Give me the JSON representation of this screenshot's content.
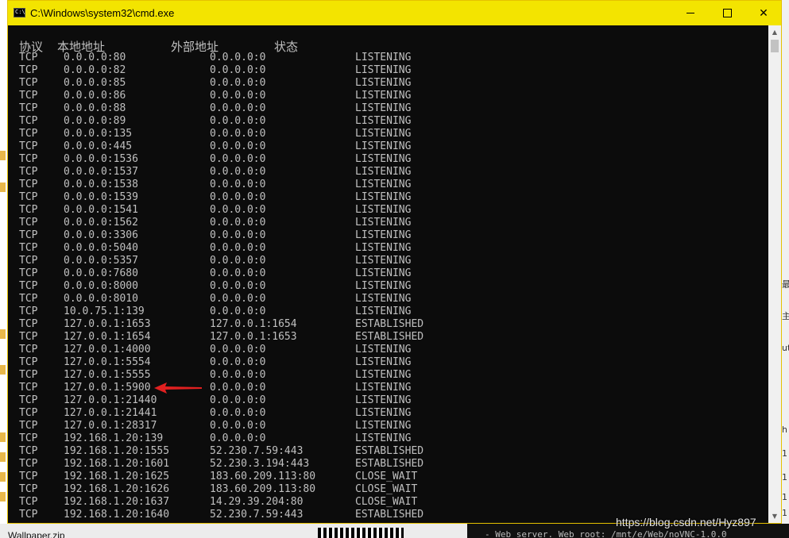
{
  "window": {
    "title": "C:\\Windows\\system32\\cmd.exe",
    "icon_text": "C:\\",
    "minimize_icon": "minimize-icon",
    "maximize_icon": "maximize-icon",
    "close_glyph": "✕"
  },
  "console": {
    "headers": {
      "proto": "协议",
      "local": "本地地址",
      "foreign": "外部地址",
      "state": "状态"
    },
    "rows": [
      {
        "proto": "TCP",
        "local": "0.0.0.0:80",
        "foreign": "0.0.0.0:0",
        "state": "LISTENING"
      },
      {
        "proto": "TCP",
        "local": "0.0.0.0:82",
        "foreign": "0.0.0.0:0",
        "state": "LISTENING"
      },
      {
        "proto": "TCP",
        "local": "0.0.0.0:85",
        "foreign": "0.0.0.0:0",
        "state": "LISTENING"
      },
      {
        "proto": "TCP",
        "local": "0.0.0.0:86",
        "foreign": "0.0.0.0:0",
        "state": "LISTENING"
      },
      {
        "proto": "TCP",
        "local": "0.0.0.0:88",
        "foreign": "0.0.0.0:0",
        "state": "LISTENING"
      },
      {
        "proto": "TCP",
        "local": "0.0.0.0:89",
        "foreign": "0.0.0.0:0",
        "state": "LISTENING"
      },
      {
        "proto": "TCP",
        "local": "0.0.0.0:135",
        "foreign": "0.0.0.0:0",
        "state": "LISTENING"
      },
      {
        "proto": "TCP",
        "local": "0.0.0.0:445",
        "foreign": "0.0.0.0:0",
        "state": "LISTENING"
      },
      {
        "proto": "TCP",
        "local": "0.0.0.0:1536",
        "foreign": "0.0.0.0:0",
        "state": "LISTENING"
      },
      {
        "proto": "TCP",
        "local": "0.0.0.0:1537",
        "foreign": "0.0.0.0:0",
        "state": "LISTENING"
      },
      {
        "proto": "TCP",
        "local": "0.0.0.0:1538",
        "foreign": "0.0.0.0:0",
        "state": "LISTENING"
      },
      {
        "proto": "TCP",
        "local": "0.0.0.0:1539",
        "foreign": "0.0.0.0:0",
        "state": "LISTENING"
      },
      {
        "proto": "TCP",
        "local": "0.0.0.0:1541",
        "foreign": "0.0.0.0:0",
        "state": "LISTENING"
      },
      {
        "proto": "TCP",
        "local": "0.0.0.0:1562",
        "foreign": "0.0.0.0:0",
        "state": "LISTENING"
      },
      {
        "proto": "TCP",
        "local": "0.0.0.0:3306",
        "foreign": "0.0.0.0:0",
        "state": "LISTENING"
      },
      {
        "proto": "TCP",
        "local": "0.0.0.0:5040",
        "foreign": "0.0.0.0:0",
        "state": "LISTENING"
      },
      {
        "proto": "TCP",
        "local": "0.0.0.0:5357",
        "foreign": "0.0.0.0:0",
        "state": "LISTENING"
      },
      {
        "proto": "TCP",
        "local": "0.0.0.0:7680",
        "foreign": "0.0.0.0:0",
        "state": "LISTENING"
      },
      {
        "proto": "TCP",
        "local": "0.0.0.0:8000",
        "foreign": "0.0.0.0:0",
        "state": "LISTENING"
      },
      {
        "proto": "TCP",
        "local": "0.0.0.0:8010",
        "foreign": "0.0.0.0:0",
        "state": "LISTENING"
      },
      {
        "proto": "TCP",
        "local": "10.0.75.1:139",
        "foreign": "0.0.0.0:0",
        "state": "LISTENING"
      },
      {
        "proto": "TCP",
        "local": "127.0.0.1:1653",
        "foreign": "127.0.0.1:1654",
        "state": "ESTABLISHED"
      },
      {
        "proto": "TCP",
        "local": "127.0.0.1:1654",
        "foreign": "127.0.0.1:1653",
        "state": "ESTABLISHED"
      },
      {
        "proto": "TCP",
        "local": "127.0.0.1:4000",
        "foreign": "0.0.0.0:0",
        "state": "LISTENING"
      },
      {
        "proto": "TCP",
        "local": "127.0.0.1:5554",
        "foreign": "0.0.0.0:0",
        "state": "LISTENING"
      },
      {
        "proto": "TCP",
        "local": "127.0.0.1:5555",
        "foreign": "0.0.0.0:0",
        "state": "LISTENING"
      },
      {
        "proto": "TCP",
        "local": "127.0.0.1:5900",
        "foreign": "0.0.0.0:0",
        "state": "LISTENING"
      },
      {
        "proto": "TCP",
        "local": "127.0.0.1:21440",
        "foreign": "0.0.0.0:0",
        "state": "LISTENING"
      },
      {
        "proto": "TCP",
        "local": "127.0.0.1:21441",
        "foreign": "0.0.0.0:0",
        "state": "LISTENING"
      },
      {
        "proto": "TCP",
        "local": "127.0.0.1:28317",
        "foreign": "0.0.0.0:0",
        "state": "LISTENING"
      },
      {
        "proto": "TCP",
        "local": "192.168.1.20:139",
        "foreign": "0.0.0.0:0",
        "state": "LISTENING"
      },
      {
        "proto": "TCP",
        "local": "192.168.1.20:1555",
        "foreign": "52.230.7.59:443",
        "state": "ESTABLISHED"
      },
      {
        "proto": "TCP",
        "local": "192.168.1.20:1601",
        "foreign": "52.230.3.194:443",
        "state": "ESTABLISHED"
      },
      {
        "proto": "TCP",
        "local": "192.168.1.20:1625",
        "foreign": "183.60.209.113:80",
        "state": "CLOSE_WAIT"
      },
      {
        "proto": "TCP",
        "local": "192.168.1.20:1626",
        "foreign": "183.60.209.113:80",
        "state": "CLOSE_WAIT"
      },
      {
        "proto": "TCP",
        "local": "192.168.1.20:1637",
        "foreign": "14.29.39.204:80",
        "state": "CLOSE_WAIT"
      },
      {
        "proto": "TCP",
        "local": "192.168.1.20:1640",
        "foreign": "52.230.7.59:443",
        "state": "ESTABLISHED"
      }
    ],
    "highlight_row": 26,
    "arrow_color": "#e02020",
    "text_color": "#c0c0c0",
    "background": "#0c0c0c"
  },
  "titlebar_color": "#f3e400",
  "scrollbar": {
    "up_icon": "▲",
    "down_icon": "▼"
  },
  "background": {
    "bottom_file": "Wallpaper.zip",
    "bottom_terminal": "- Web server. Web root: /mnt/e/Web/noVNC-1.0.0",
    "watermark": "https://blog.csdn.net/Hyz897",
    "right_glyphs": [
      "最",
      "主",
      "ut",
      "h",
      "1",
      "1",
      "1",
      "1"
    ]
  }
}
